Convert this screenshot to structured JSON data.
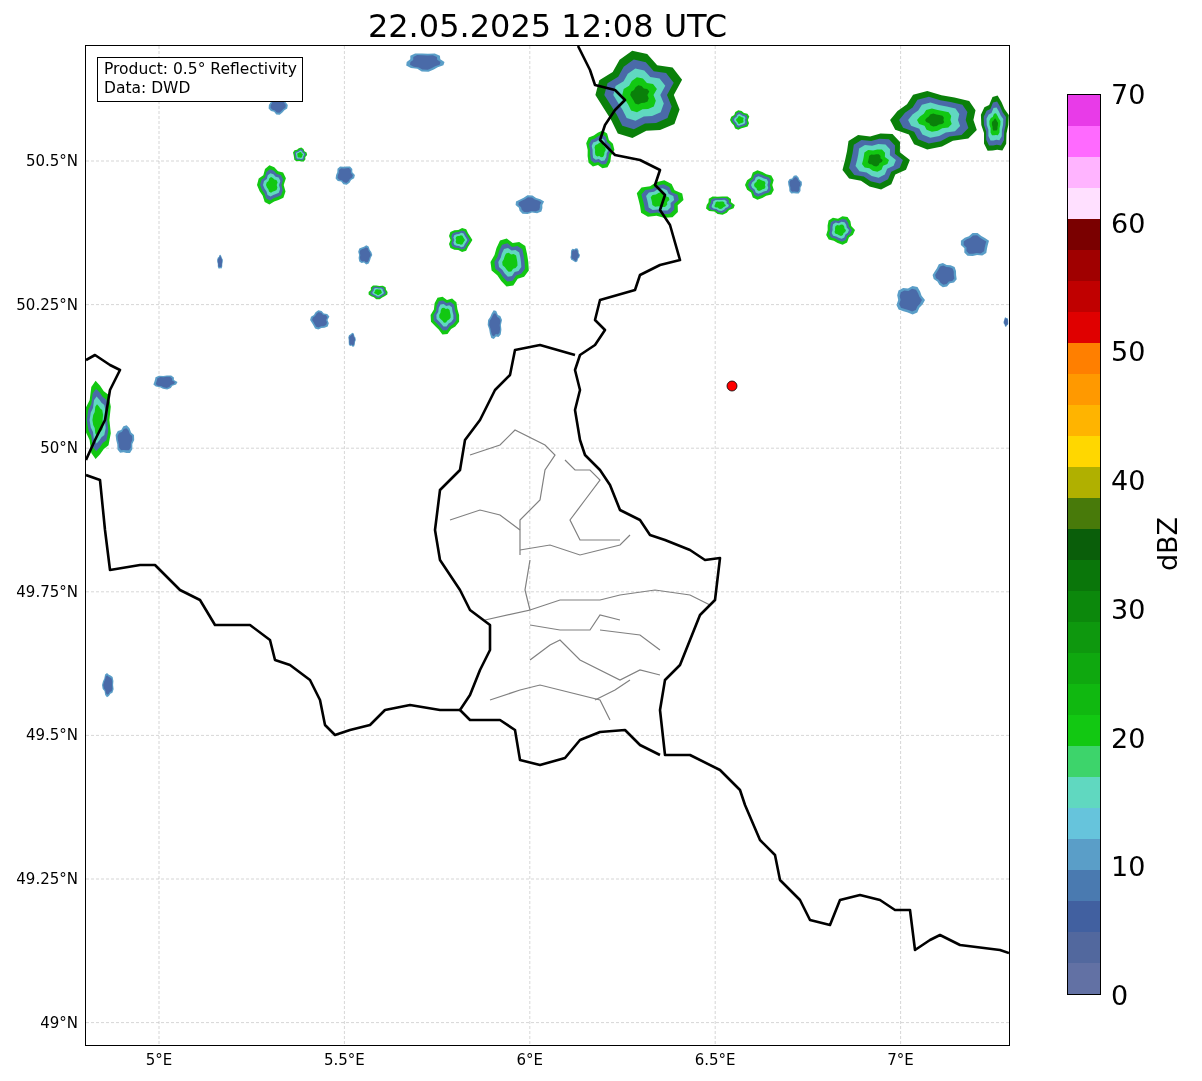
{
  "title": "22.05.2025 12:08 UTC",
  "legend": [
    "Product: 0.5° Reflectivity",
    "Data: DWD"
  ],
  "x_ticks": [
    "5°E",
    "5.5°E",
    "6°E",
    "6.5°E",
    "7°E"
  ],
  "y_ticks": [
    "50.5°N",
    "50.25°N",
    "50°N",
    "49.75°N",
    "49.5°N",
    "49.25°N",
    "49°N"
  ],
  "colorbar": {
    "label": "dBZ",
    "ticks": [
      "70",
      "60",
      "50",
      "40",
      "30",
      "20",
      "10",
      "0"
    ],
    "bands": [
      {
        "color": "#e83be8"
      },
      {
        "color": "#ff6aff"
      },
      {
        "color": "#ffb4ff"
      },
      {
        "color": "#ffe0ff"
      },
      {
        "color": "#7a0000"
      },
      {
        "color": "#a00000"
      },
      {
        "color": "#c00000"
      },
      {
        "color": "#e00000"
      },
      {
        "color": "#ff7f00"
      },
      {
        "color": "#ff9900"
      },
      {
        "color": "#ffb400"
      },
      {
        "color": "#ffd700"
      },
      {
        "color": "#b0b000"
      },
      {
        "color": "#487a0a"
      },
      {
        "color": "#0a5e0a"
      },
      {
        "color": "#0a760a"
      },
      {
        "color": "#0c880c"
      },
      {
        "color": "#0e980e"
      },
      {
        "color": "#0fa80f"
      },
      {
        "color": "#10b810"
      },
      {
        "color": "#12c812"
      },
      {
        "color": "#3dd46b"
      },
      {
        "color": "#60d8c0"
      },
      {
        "color": "#66c4dc"
      },
      {
        "color": "#5a9ec8"
      },
      {
        "color": "#4a7ab0"
      },
      {
        "color": "#4160a0"
      },
      {
        "color": "#52689e"
      },
      {
        "color": "#6271a4"
      }
    ]
  }
}
